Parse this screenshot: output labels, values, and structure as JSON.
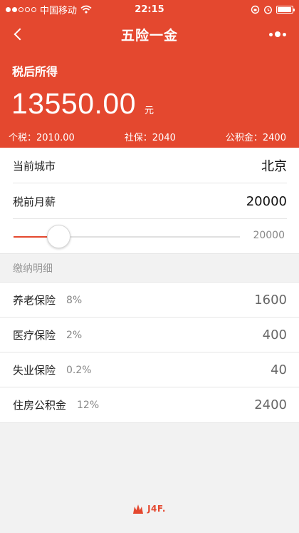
{
  "status_bar": {
    "carrier": "中国移动",
    "time": "22:15",
    "battery_level": 0.95
  },
  "nav": {
    "title": "五险一金",
    "back_icon": "chevron-left-icon",
    "more_icon": "more-dots-icon"
  },
  "summary": {
    "income_label": "税后所得",
    "income_value": "13550.00",
    "income_unit": "元",
    "tax": "个税：2010.00",
    "social_security": "社保：2040",
    "housing_fund": "公积金：2400"
  },
  "settings": {
    "city_label": "当前城市",
    "city_value": "北京",
    "salary_label": "税前月薪",
    "salary_value": "20000"
  },
  "slider": {
    "value_text": "20000",
    "level": 0.2
  },
  "details": {
    "section_title": "缴纳明细",
    "items": [
      {
        "name": "养老保险",
        "rate": "8%",
        "amount": "1600"
      },
      {
        "name": "医疗保险",
        "rate": "2%",
        "amount": "400"
      },
      {
        "name": "失业保险",
        "rate": "0.2%",
        "amount": "40"
      },
      {
        "name": "住房公积金",
        "rate": "12%",
        "amount": "2400"
      }
    ]
  },
  "footer": {
    "logo_text": "J4F."
  },
  "colors": {
    "accent": "#e4482f",
    "background": "#f2f2f2"
  }
}
